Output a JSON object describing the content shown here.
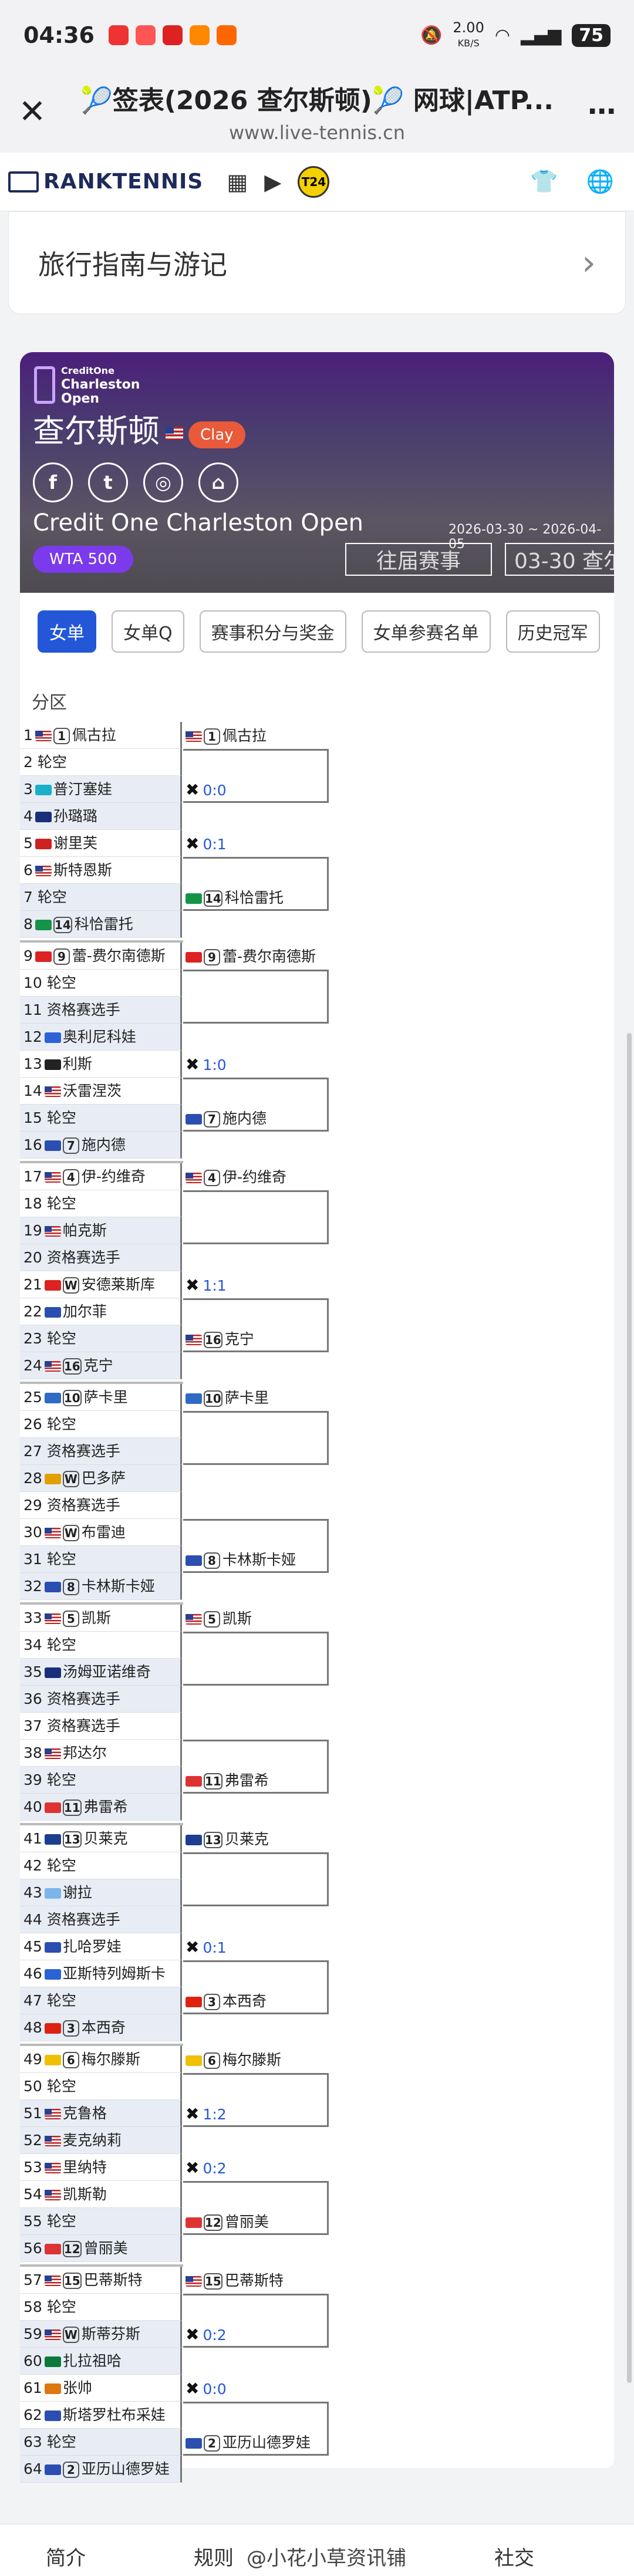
{
  "status": {
    "time": "04:36",
    "speed": "2.00",
    "speed_unit": "KB/S",
    "battery": "75"
  },
  "browser": {
    "title": "🎾签表(2026 查尔斯顿)🎾 网球|ATP...",
    "url": "www.live-tennis.cn"
  },
  "site": {
    "logo": "RANKTENNIS",
    "t24": "T24"
  },
  "guide": {
    "label": "旅行指南与游记"
  },
  "tournament": {
    "logo_line1": "CreditOne",
    "logo_line2": "Charleston",
    "logo_line3": "Open",
    "city": "查尔斯顿",
    "surface": "Clay",
    "name": "Credit One Charleston Open",
    "dates": "2026-03-30 ~ 2026-04-05",
    "category": "WTA 500",
    "past_label": "往届赛事",
    "date_label": "03-30 查尔"
  },
  "tabs": [
    "女单",
    "女单Q",
    "赛事积分与奖金",
    "女单参赛名单",
    "历史冠军"
  ],
  "bracket": {
    "header": "分区",
    "r1": [
      {
        "n": "1",
        "f": "us",
        "s": "1",
        "name": "佩古拉"
      },
      {
        "n": "2",
        "f": "",
        "s": "",
        "name": "轮空"
      },
      {
        "n": "3",
        "f": "kz",
        "s": "",
        "name": "普汀塞娃"
      },
      {
        "n": "4",
        "f": "au",
        "s": "",
        "name": "孙璐璐"
      },
      {
        "n": "5",
        "f": "th",
        "s": "",
        "name": "谢里芙"
      },
      {
        "n": "6",
        "f": "us",
        "s": "",
        "name": "斯特恩斯"
      },
      {
        "n": "7",
        "f": "",
        "s": "",
        "name": "轮空"
      },
      {
        "n": "8",
        "f": "it",
        "s": "14",
        "name": "科恰雷托"
      },
      {
        "n": "9",
        "f": "ca",
        "s": "9",
        "name": "蕾-费尔南德斯"
      },
      {
        "n": "10",
        "f": "",
        "s": "",
        "name": "轮空"
      },
      {
        "n": "11",
        "f": "",
        "s": "",
        "name": "资格赛选手"
      },
      {
        "n": "12",
        "f": "ua",
        "s": "",
        "name": "奥利尼科娃"
      },
      {
        "n": "13",
        "f": "de",
        "s": "",
        "name": "利斯"
      },
      {
        "n": "14",
        "f": "us",
        "s": "",
        "name": "沃雷涅茨"
      },
      {
        "n": "15",
        "f": "",
        "s": "",
        "name": "轮空"
      },
      {
        "n": "16",
        "f": "ru",
        "s": "7",
        "name": "施内德"
      },
      {
        "n": "17",
        "f": "us",
        "s": "4",
        "name": "伊-约维奇"
      },
      {
        "n": "18",
        "f": "",
        "s": "",
        "name": "轮空"
      },
      {
        "n": "19",
        "f": "us",
        "s": "",
        "name": "帕克斯"
      },
      {
        "n": "20",
        "f": "",
        "s": "",
        "name": "资格赛选手"
      },
      {
        "n": "21",
        "f": "ca",
        "s": "W",
        "name": "安德莱斯库"
      },
      {
        "n": "22",
        "f": "ru",
        "s": "",
        "name": "加尔菲"
      },
      {
        "n": "23",
        "f": "",
        "s": "",
        "name": "轮空"
      },
      {
        "n": "24",
        "f": "us",
        "s": "16",
        "name": "克宁"
      },
      {
        "n": "25",
        "f": "gr",
        "s": "10",
        "name": "萨卡里"
      },
      {
        "n": "26",
        "f": "",
        "s": "",
        "name": "轮空"
      },
      {
        "n": "27",
        "f": "",
        "s": "",
        "name": "资格赛选手"
      },
      {
        "n": "28",
        "f": "es",
        "s": "W",
        "name": "巴多萨"
      },
      {
        "n": "29",
        "f": "",
        "s": "",
        "name": "资格赛选手"
      },
      {
        "n": "30",
        "f": "us",
        "s": "W",
        "name": "布雷迪"
      },
      {
        "n": "31",
        "f": "",
        "s": "",
        "name": "轮空"
      },
      {
        "n": "32",
        "f": "ru",
        "s": "8",
        "name": "卡林斯卡娅"
      },
      {
        "n": "33",
        "f": "us",
        "s": "5",
        "name": "凯斯"
      },
      {
        "n": "34",
        "f": "",
        "s": "",
        "name": "轮空"
      },
      {
        "n": "35",
        "f": "au",
        "s": "",
        "name": "汤姆亚诺维奇"
      },
      {
        "n": "36",
        "f": "",
        "s": "",
        "name": "资格赛选手"
      },
      {
        "n": "37",
        "f": "",
        "s": "",
        "name": "资格赛选手"
      },
      {
        "n": "38",
        "f": "us",
        "s": "",
        "name": "邦达尔"
      },
      {
        "n": "39",
        "f": "",
        "s": "",
        "name": "轮空"
      },
      {
        "n": "40",
        "f": "pl",
        "s": "11",
        "name": "弗雷希"
      },
      {
        "n": "41",
        "f": "cz",
        "s": "13",
        "name": "贝莱克"
      },
      {
        "n": "42",
        "f": "",
        "s": "",
        "name": "轮空"
      },
      {
        "n": "43",
        "f": "ar",
        "s": "",
        "name": "谢拉"
      },
      {
        "n": "44",
        "f": "",
        "s": "",
        "name": "资格赛选手"
      },
      {
        "n": "45",
        "f": "ru",
        "s": "",
        "name": "扎哈罗娃"
      },
      {
        "n": "46",
        "f": "ua",
        "s": "",
        "name": "亚斯特列姆斯卡"
      },
      {
        "n": "47",
        "f": "",
        "s": "",
        "name": "轮空"
      },
      {
        "n": "48",
        "f": "ch",
        "s": "3",
        "name": "本西奇"
      },
      {
        "n": "49",
        "f": "be",
        "s": "6",
        "name": "梅尔滕斯"
      },
      {
        "n": "50",
        "f": "",
        "s": "",
        "name": "轮空"
      },
      {
        "n": "51",
        "f": "us",
        "s": "",
        "name": "克鲁格"
      },
      {
        "n": "52",
        "f": "us",
        "s": "",
        "name": "麦克纳莉"
      },
      {
        "n": "53",
        "f": "us",
        "s": "",
        "name": "里纳特"
      },
      {
        "n": "54",
        "f": "us",
        "s": "",
        "name": "凯斯勒"
      },
      {
        "n": "55",
        "f": "",
        "s": "",
        "name": "轮空"
      },
      {
        "n": "56",
        "f": "pl",
        "s": "12",
        "name": "曾丽美"
      },
      {
        "n": "57",
        "f": "us",
        "s": "15",
        "name": "巴蒂斯特"
      },
      {
        "n": "58",
        "f": "",
        "s": "",
        "name": "轮空"
      },
      {
        "n": "59",
        "f": "us",
        "s": "W",
        "name": "斯蒂芬斯"
      },
      {
        "n": "60",
        "f": "mx",
        "s": "",
        "name": "扎拉祖哈"
      },
      {
        "n": "61",
        "f": "cn",
        "s": "",
        "name": "张帅"
      },
      {
        "n": "62",
        "f": "ru",
        "s": "",
        "name": "斯塔罗杜布采娃"
      },
      {
        "n": "63",
        "f": "",
        "s": "",
        "name": "轮空"
      },
      {
        "n": "64",
        "f": "ru",
        "s": "2",
        "name": "亚历山德罗娃"
      }
    ],
    "r2": [
      {
        "f": "us",
        "s": "1",
        "name": "佩古拉"
      },
      {
        "score": "0:0"
      },
      {
        "score": "0:1"
      },
      {
        "f": "it",
        "s": "14",
        "name": "科恰雷托"
      },
      {
        "f": "ca",
        "s": "9",
        "name": "蕾-费尔南德斯"
      },
      {},
      {
        "score": "1:0"
      },
      {
        "f": "ru",
        "s": "7",
        "name": "施内德"
      },
      {
        "f": "us",
        "s": "4",
        "name": "伊-约维奇"
      },
      {},
      {
        "score": "1:1"
      },
      {
        "f": "us",
        "s": "16",
        "name": "克宁"
      },
      {
        "f": "gr",
        "s": "10",
        "name": "萨卡里"
      },
      {},
      {},
      {
        "f": "ru",
        "s": "8",
        "name": "卡林斯卡娅"
      },
      {
        "f": "us",
        "s": "5",
        "name": "凯斯"
      },
      {},
      {},
      {
        "f": "pl",
        "s": "11",
        "name": "弗雷希"
      },
      {
        "f": "cz",
        "s": "13",
        "name": "贝莱克"
      },
      {},
      {
        "score": "0:1"
      },
      {
        "f": "ch",
        "s": "3",
        "name": "本西奇"
      },
      {
        "f": "be",
        "s": "6",
        "name": "梅尔滕斯"
      },
      {
        "score": "1:2"
      },
      {
        "score": "0:2"
      },
      {
        "f": "pl",
        "s": "12",
        "name": "曾丽美"
      },
      {
        "f": "us",
        "s": "15",
        "name": "巴蒂斯特"
      },
      {
        "score": "0:2"
      },
      {
        "score": "0:0"
      },
      {
        "f": "ru",
        "s": "2",
        "name": "亚历山德罗娃"
      }
    ]
  },
  "colors": {
    "accent": "#2357d8",
    "purple": "#7c3aed",
    "clay": "#e85a3a"
  },
  "bottom_nav": [
    "简介",
    "规则",
    "@小花小草资讯铺",
    "社交"
  ]
}
